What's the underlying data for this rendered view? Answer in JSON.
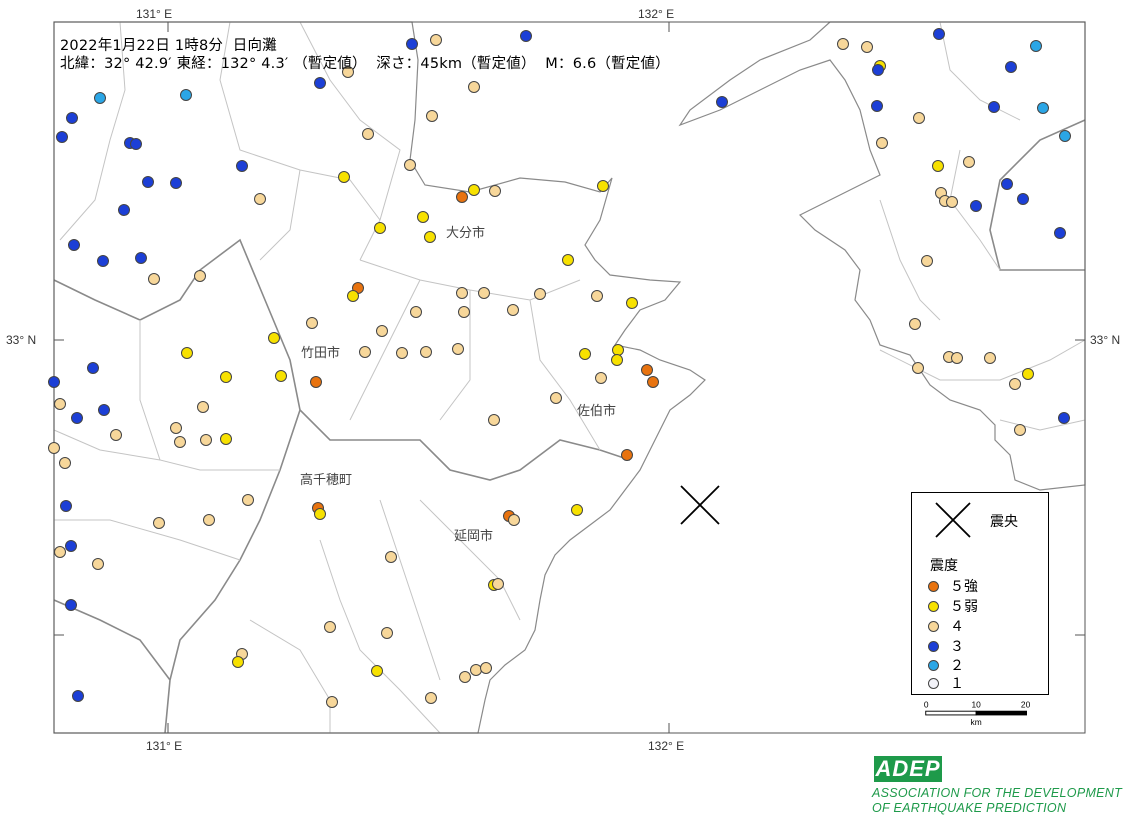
{
  "header": {
    "line1": "2022年1月22日 1時8分  日向灘",
    "line2": "北緯：32° 42.9′ 東経：132° 4.3′ （暫定値）  深さ：45km（暫定値）  M：6.6（暫定値）"
  },
  "axes": {
    "top_labels": [
      "131° E",
      "132° E"
    ],
    "bottom_labels": [
      "131° E",
      "132° E"
    ],
    "left_labels": [
      "33° N"
    ],
    "right_labels": [
      "33° N"
    ]
  },
  "cities": [
    "大分市",
    "竹田市",
    "佐伯市",
    "高千穂町",
    "延岡市"
  ],
  "legend": {
    "epicenter_label": "震央",
    "intensity_title": "震度",
    "items": [
      {
        "label": "５強",
        "color": "#e8730f"
      },
      {
        "label": "５弱",
        "color": "#f7e100"
      },
      {
        "label": "４",
        "color": "#f7d79a"
      },
      {
        "label": "３",
        "color": "#1c3fd6"
      },
      {
        "label": "２",
        "color": "#2ba6e6"
      },
      {
        "label": "１",
        "color": "#f2f2f8"
      }
    ]
  },
  "scale": {
    "ticks": [
      "0",
      "10",
      "20"
    ],
    "unit": "km"
  },
  "logo": {
    "acronym": "ADEP",
    "line1": "ASSOCIATION  FOR THE DEVELOPMENT",
    "line2": "OF EARTHQUAKE PREDICTION"
  }
}
